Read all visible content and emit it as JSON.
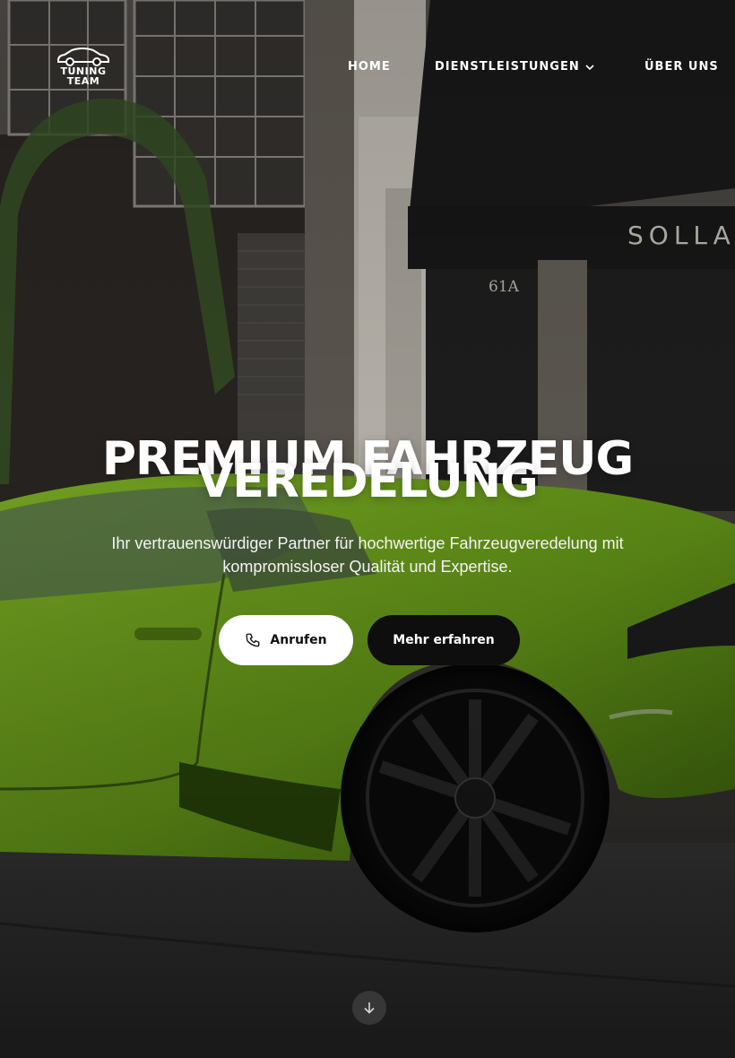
{
  "logo": {
    "line1": "TUNING",
    "line2": "TEAM"
  },
  "nav": {
    "home": "HOME",
    "services": "DIENSTLEISTUNGEN",
    "about": "ÜBER UNS"
  },
  "background_sign": {
    "store": "SOLLA",
    "number": "61A"
  },
  "hero": {
    "title_line1": "PREMIUM FAHRZEUG",
    "title_line2": "VEREDELUNG",
    "subtitle_line1": "Ihr vertrauenswürdiger Partner für hochwertige Fahrzeugveredelung mit",
    "subtitle_line2": "kompromissloser Qualität und Expertise.",
    "call_button": "Anrufen",
    "more_button": "Mehr erfahren"
  },
  "colors": {
    "car_green": "#7bb31e",
    "button_light": "#ffffff",
    "button_dark": "#0e0e0e",
    "text": "#ffffff"
  },
  "icons": [
    "phone-icon",
    "chevron-down-icon",
    "arrow-down-icon",
    "car-logo-icon"
  ]
}
